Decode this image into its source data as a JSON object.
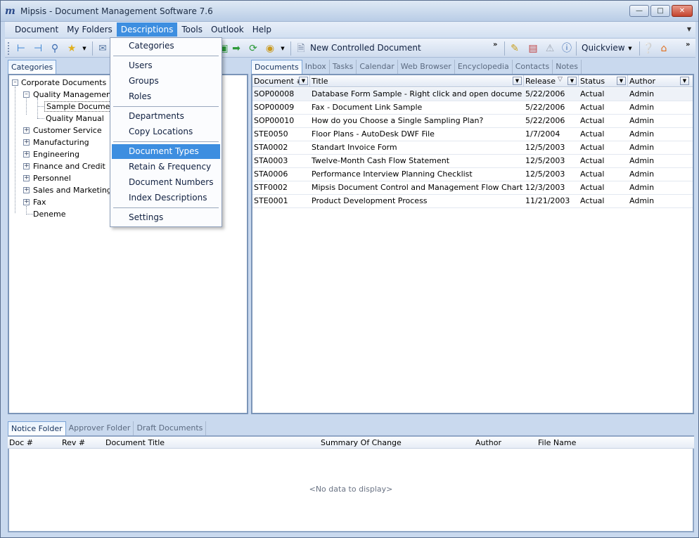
{
  "window": {
    "title": "Mipsis - Document Management Software 7.6",
    "app_icon": "m"
  },
  "menubar": {
    "items": [
      "Document",
      "My Folders",
      "Descriptions",
      "Tools",
      "Outlook",
      "Help"
    ],
    "active": "Descriptions"
  },
  "toolbar": {
    "new_controlled_document": "New Controlled Document",
    "quickview": "Quickview"
  },
  "descriptions_menu": {
    "items": [
      "Categories",
      "Users",
      "Groups",
      "Roles",
      "Departments",
      "Copy Locations",
      "Document Types",
      "Retain & Frequency",
      "Document Numbers",
      "Index Descriptions",
      "Settings"
    ],
    "highlighted": "Document Types"
  },
  "left_tabs": [
    "Categories"
  ],
  "tree": {
    "root": "Corporate Documents",
    "quality_management": "Quality Management",
    "sample_documents": "Sample Documents",
    "quality_manual": "Quality Manual",
    "customer_service": "Customer Service",
    "manufacturing": "Manufacturing",
    "engineering": "Engineering",
    "finance": "Finance and Credit",
    "personnel": "Personnel",
    "sales": "Sales and Marketing",
    "fax": "Fax",
    "deneme": "Deneme"
  },
  "right_tabs": [
    "Documents",
    "Inbox",
    "Tasks",
    "Calendar",
    "Web Browser",
    "Encyclopedia",
    "Contacts",
    "Notes"
  ],
  "documents_grid": {
    "columns": [
      "Document #",
      "Title",
      "Release",
      "Status",
      "Author"
    ],
    "rows": [
      [
        "SOP00008",
        "Database Form Sample - Right click and open document",
        "5/22/2006",
        "Actual",
        "Admin"
      ],
      [
        "SOP00009",
        "Fax - Document Link Sample",
        "5/22/2006",
        "Actual",
        "Admin"
      ],
      [
        "SOP00010",
        "How do you Choose a Single Sampling Plan?",
        "5/22/2006",
        "Actual",
        "Admin"
      ],
      [
        "STE0050",
        "Floor Plans - AutoDesk DWF File",
        "1/7/2004",
        "Actual",
        "Admin"
      ],
      [
        "STA0002",
        "Standart Invoice Form",
        "12/5/2003",
        "Actual",
        "Admin"
      ],
      [
        "STA0003",
        "Twelve-Month Cash Flow Statement",
        "12/5/2003",
        "Actual",
        "Admin"
      ],
      [
        "STA0006",
        "Performance Interview Planning Checklist",
        "12/5/2003",
        "Actual",
        "Admin"
      ],
      [
        "STF0002",
        "Mipsis Document Control and Management Flow Chart",
        "12/3/2003",
        "Actual",
        "Admin"
      ],
      [
        "STE0001",
        "Product Development Process",
        "11/21/2003",
        "Actual",
        "Admin"
      ]
    ]
  },
  "bottom_tabs": [
    "Notice Folder",
    "Approver Folder",
    "Draft Documents"
  ],
  "notice_grid": {
    "columns": [
      "Doc #",
      "Rev #",
      "Document Title",
      "Summary Of Change",
      "Author",
      "File Name"
    ],
    "empty_text": "<No data to display>"
  },
  "colors": {
    "accent": "#3d8ee0",
    "frame": "#c9d9ee"
  }
}
